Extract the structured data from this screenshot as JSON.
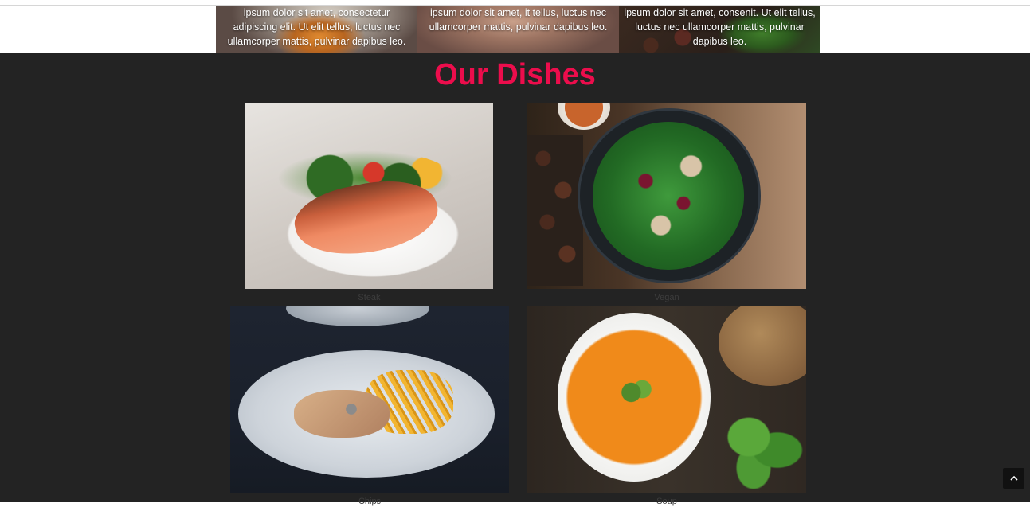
{
  "features": [
    {
      "text": "ipsum dolor sit amet, consectetur adipiscing elit. Ut elit tellus, luctus nec ullamcorper mattis, pulvinar dapibus leo."
    },
    {
      "text": "ipsum dolor sit amet, it tellus, luctus nec ullamcorper mattis, pulvinar dapibus leo."
    },
    {
      "text": "ipsum dolor sit amet, consenit. Ut elit tellus, luctus nec ullamcorper mattis, pulvinar dapibus leo."
    }
  ],
  "dishes": {
    "title": "Our Dishes",
    "title_color": "#ec0d4c",
    "items": [
      {
        "caption": "Steak",
        "image": "salmon-steak-photo"
      },
      {
        "caption": "Vegan",
        "image": "salad-bowl-photo"
      },
      {
        "caption": "Chips",
        "image": "chicken-fries-photo"
      },
      {
        "caption": "Soup",
        "image": "tomato-soup-photo"
      }
    ]
  },
  "scroll_top": {
    "icon": "chevron-up-icon"
  }
}
